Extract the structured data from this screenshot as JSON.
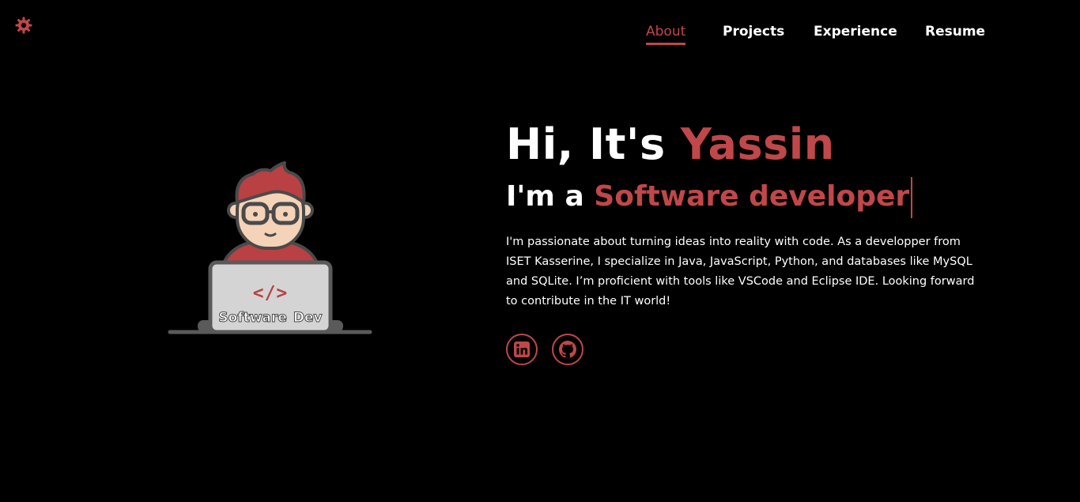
{
  "nav": {
    "items": [
      {
        "label": "About",
        "active": true
      },
      {
        "label": "Projects",
        "active": false
      },
      {
        "label": "Experience",
        "active": false
      },
      {
        "label": "Resume",
        "active": false
      }
    ]
  },
  "hero": {
    "greeting_prefix": "Hi, It's ",
    "name": "Yassin",
    "role_prefix": "I'm a ",
    "role": "Software developer",
    "bio": "I'm passionate about turning ideas into reality with code. As a developper from ISET Kasserine, I specialize in Java, JavaScript, Python, and databases like MySQL and SQLite. I’m proficient with tools like VSCode and Eclipse IDE. Looking forward to contribute in the IT world!"
  },
  "illustration": {
    "code_glyph": "</>",
    "laptop_label": "Software Dev"
  },
  "socials": [
    {
      "icon": "linkedin-icon"
    },
    {
      "icon": "github-icon"
    }
  ],
  "theme_toggle_icon": "gear-icon",
  "colors": {
    "accent": "#c0474a",
    "background": "#000000",
    "text": "#ffffff"
  }
}
